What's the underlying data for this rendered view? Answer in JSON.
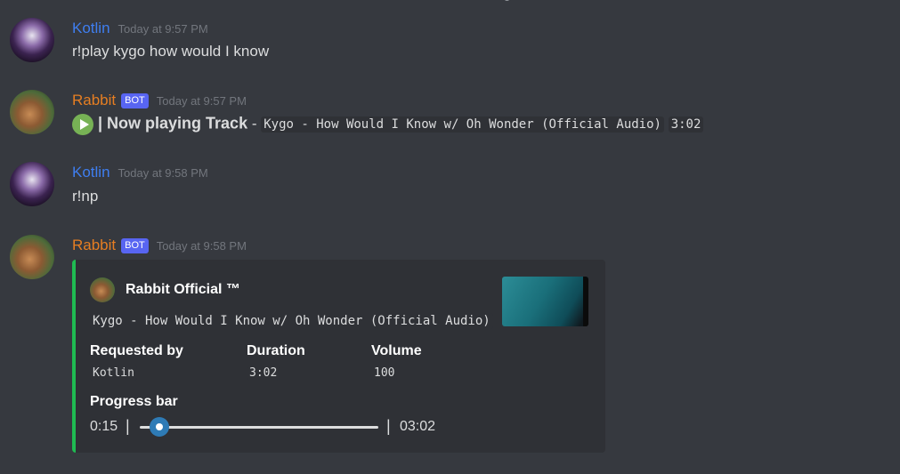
{
  "messages": [
    {
      "author": "Kotlin",
      "timestamp": "Today at 9:57 PM",
      "text": "r!play kygo how would I know"
    },
    {
      "author": "Rabbit",
      "bot_tag": "BOT",
      "timestamp": "Today at 9:57 PM",
      "now_playing_label": "| Now playing Track",
      "dash": "-",
      "track_title": "Kygo - How Would I Know w/ Oh Wonder (Official Audio)",
      "duration": "3:02"
    },
    {
      "author": "Kotlin",
      "timestamp": "Today at 9:58 PM",
      "text": "r!np"
    },
    {
      "author": "Rabbit",
      "bot_tag": "BOT",
      "timestamp": "Today at 9:58 PM"
    }
  ],
  "embed": {
    "accent_color": "#1fbb52",
    "author_name": "Rabbit Official ™",
    "description": "Kygo - How Would I Know w/ Oh Wonder (Official Audio)",
    "fields": [
      {
        "name": "Requested by",
        "value": "Kotlin"
      },
      {
        "name": "Duration",
        "value": "3:02"
      },
      {
        "name": "Volume",
        "value": "100"
      }
    ],
    "progress": {
      "label": "Progress bar",
      "current": "0:15",
      "total": "03:02",
      "fraction": 0.082,
      "separator": "|"
    }
  },
  "colors": {
    "background": "#36393f",
    "kotlin_name": "#3f7ef0",
    "rabbit_name": "#e67e22",
    "bot_tag": "#5865f2"
  }
}
